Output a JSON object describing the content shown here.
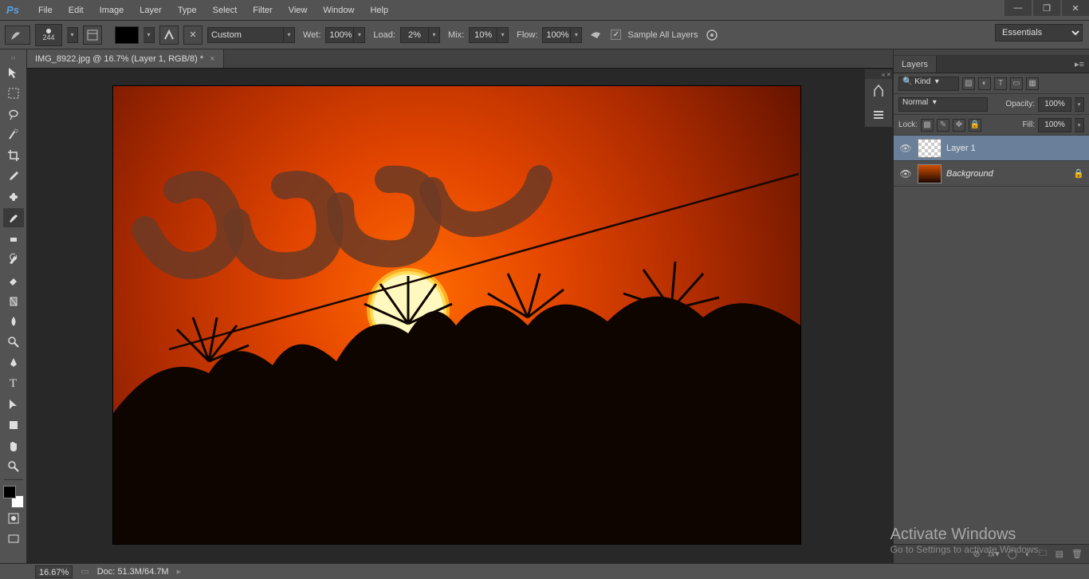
{
  "app": {
    "logo": "Ps"
  },
  "menus": [
    "File",
    "Edit",
    "Image",
    "Layer",
    "Type",
    "Select",
    "Filter",
    "View",
    "Window",
    "Help"
  ],
  "options": {
    "brush_size": "244",
    "preset": "Custom",
    "wet_label": "Wet:",
    "wet_value": "100%",
    "load_label": "Load:",
    "load_value": "2%",
    "mix_label": "Mix:",
    "mix_value": "10%",
    "flow_label": "Flow:",
    "flow_value": "100%",
    "sample_all": "Sample All Layers"
  },
  "workspace": "Essentials",
  "document": {
    "tab_title": "IMG_8922.jpg @ 16.7% (Layer 1, RGB/8) *",
    "zoom": "16.67%",
    "doc_info": "Doc: 51.3M/64.7M"
  },
  "layers_panel": {
    "title": "Layers",
    "filter": "Kind",
    "blend_mode": "Normal",
    "opacity_label": "Opacity:",
    "opacity_value": "100%",
    "lock_label": "Lock:",
    "fill_label": "Fill:",
    "fill_value": "100%",
    "layers": [
      {
        "name": "Layer 1",
        "selected": true,
        "transparent_thumb": true,
        "visible": true,
        "italic": false,
        "locked": false
      },
      {
        "name": "Background",
        "selected": false,
        "transparent_thumb": false,
        "visible": true,
        "italic": true,
        "locked": true
      }
    ]
  },
  "watermark": {
    "line1": "Activate Windows",
    "line2": "Go to Settings to activate Windows."
  }
}
